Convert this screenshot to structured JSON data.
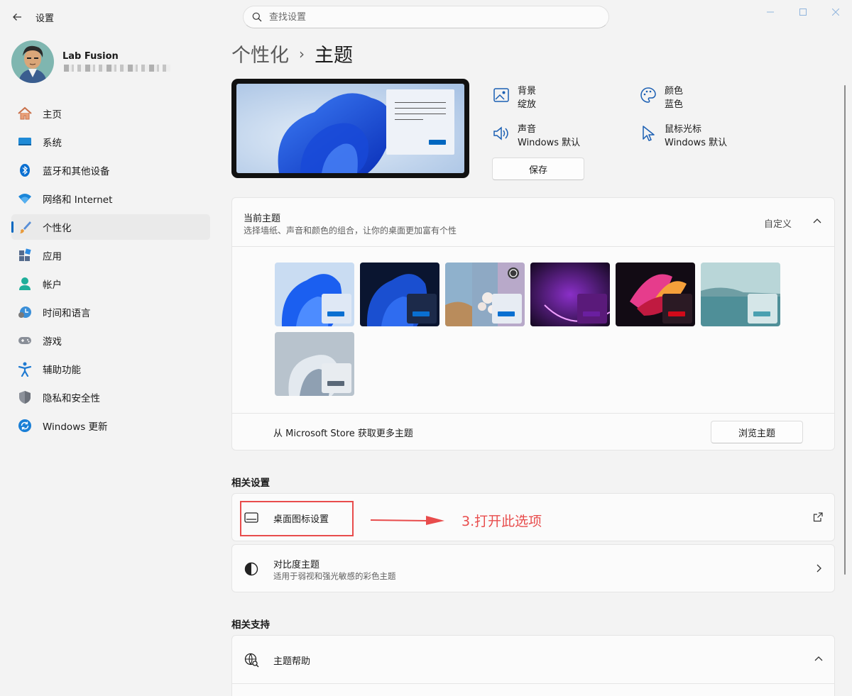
{
  "window": {
    "app_title": "设置",
    "search_placeholder": "查找设置"
  },
  "profile": {
    "name": "Lab Fusion"
  },
  "nav": [
    {
      "label": "主页",
      "icon": "home-icon"
    },
    {
      "label": "系统",
      "icon": "system-icon"
    },
    {
      "label": "蓝牙和其他设备",
      "icon": "bluetooth-icon"
    },
    {
      "label": "网络和 Internet",
      "icon": "wifi-icon"
    },
    {
      "label": "个性化",
      "icon": "brush-icon",
      "active": true
    },
    {
      "label": "应用",
      "icon": "apps-icon"
    },
    {
      "label": "帐户",
      "icon": "account-icon"
    },
    {
      "label": "时间和语言",
      "icon": "time-language-icon"
    },
    {
      "label": "游戏",
      "icon": "gamepad-icon"
    },
    {
      "label": "辅助功能",
      "icon": "accessibility-icon"
    },
    {
      "label": "隐私和安全性",
      "icon": "shield-icon"
    },
    {
      "label": "Windows 更新",
      "icon": "update-icon"
    }
  ],
  "breadcrumb": {
    "parent": "个性化",
    "separator": "›",
    "current": "主题"
  },
  "properties": {
    "background": {
      "label": "背景",
      "value": "绽放"
    },
    "color": {
      "label": "颜色",
      "value": "蓝色"
    },
    "sound": {
      "label": "声音",
      "value": "Windows 默认"
    },
    "cursor": {
      "label": "鼠标光标",
      "value": "Windows 默认"
    }
  },
  "save_label": "保存",
  "current_theme": {
    "title": "当前主题",
    "subtitle": "选择墙纸、声音和颜色的组合，让你的桌面更加富有个性",
    "mode": "自定义"
  },
  "store": {
    "text": "从 Microsoft Store 获取更多主题",
    "button": "浏览主题"
  },
  "related_settings": {
    "title": "相关设置",
    "desktop_icons": "桌面图标设置",
    "contrast_title": "对比度主题",
    "contrast_sub": "适用于弱视和强光敏感的彩色主题"
  },
  "related_support": {
    "title": "相关支持",
    "help": "主题帮助"
  },
  "annotation": "3.打开此选项",
  "colors": {
    "accent": "#0067c0",
    "annotation": "#e84c4c"
  }
}
